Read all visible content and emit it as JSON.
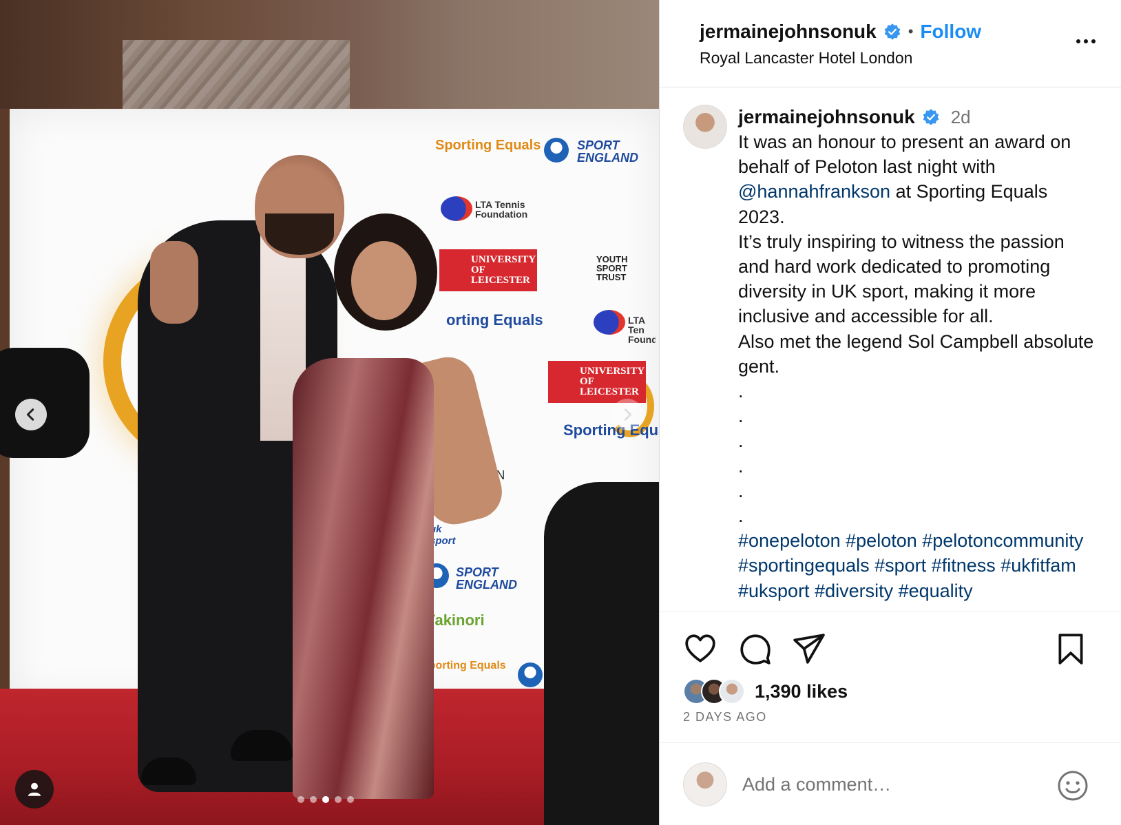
{
  "post": {
    "username": "jermainejohnsonuk",
    "follow_label": "Follow",
    "separator": "•",
    "location": "Royal Lancaster Hotel London",
    "more_label": "..."
  },
  "caption": {
    "username": "jermainejohnsonuk",
    "time": "2d",
    "line1_a": "It was an honour to present an award on behalf of Peloton last night with ",
    "mention": "@hannahfrankson",
    "line1_b": " at Sporting Equals 2023.",
    "line2": "It’s truly inspiring to witness the passion and hard work dedicated to promoting diversity in UK sport, making it more inclusive and accessible for all.",
    "line3": "Also met the legend Sol Campbell absolute gent.",
    "dots": [
      ".",
      ".",
      ".",
      ".",
      ".",
      "."
    ],
    "hashtags": "#onepeloton #peloton #pelotoncommunity #sportingequals #sport #fitness #ukfitfam #uksport #diversity #equality"
  },
  "actions": {
    "likes": "1,390 likes",
    "ago": "2 DAYS AGO"
  },
  "comment": {
    "placeholder": "Add a comment…"
  },
  "media": {
    "carousel_dots": 5,
    "active_dot": 3,
    "backdrop_logos": {
      "sporting_equals": "Sporting Equals",
      "sporting_equals_a": "Sporting",
      "sporting_equals_b": "Equals",
      "sport_england": "SPORT ENGLAND",
      "lta": "LTA Tennis Foundation",
      "lta_partial": "LTA Ten Founda",
      "uol": "UNIVERSITY OF LEICESTER",
      "yst": "YOUTH SPORT TRUST",
      "peloton_partial": "PEL     ON",
      "yakinori": "Yakinori",
      "uk_sport": "uk sport",
      "sporting_equals_partial": "Sporting Equa",
      "sporting_equals_mid": "orting Equals"
    }
  },
  "colors": {
    "accent": "#1b8cf2",
    "link": "#00376b",
    "muted": "#737373",
    "verified": "#3897f0"
  }
}
